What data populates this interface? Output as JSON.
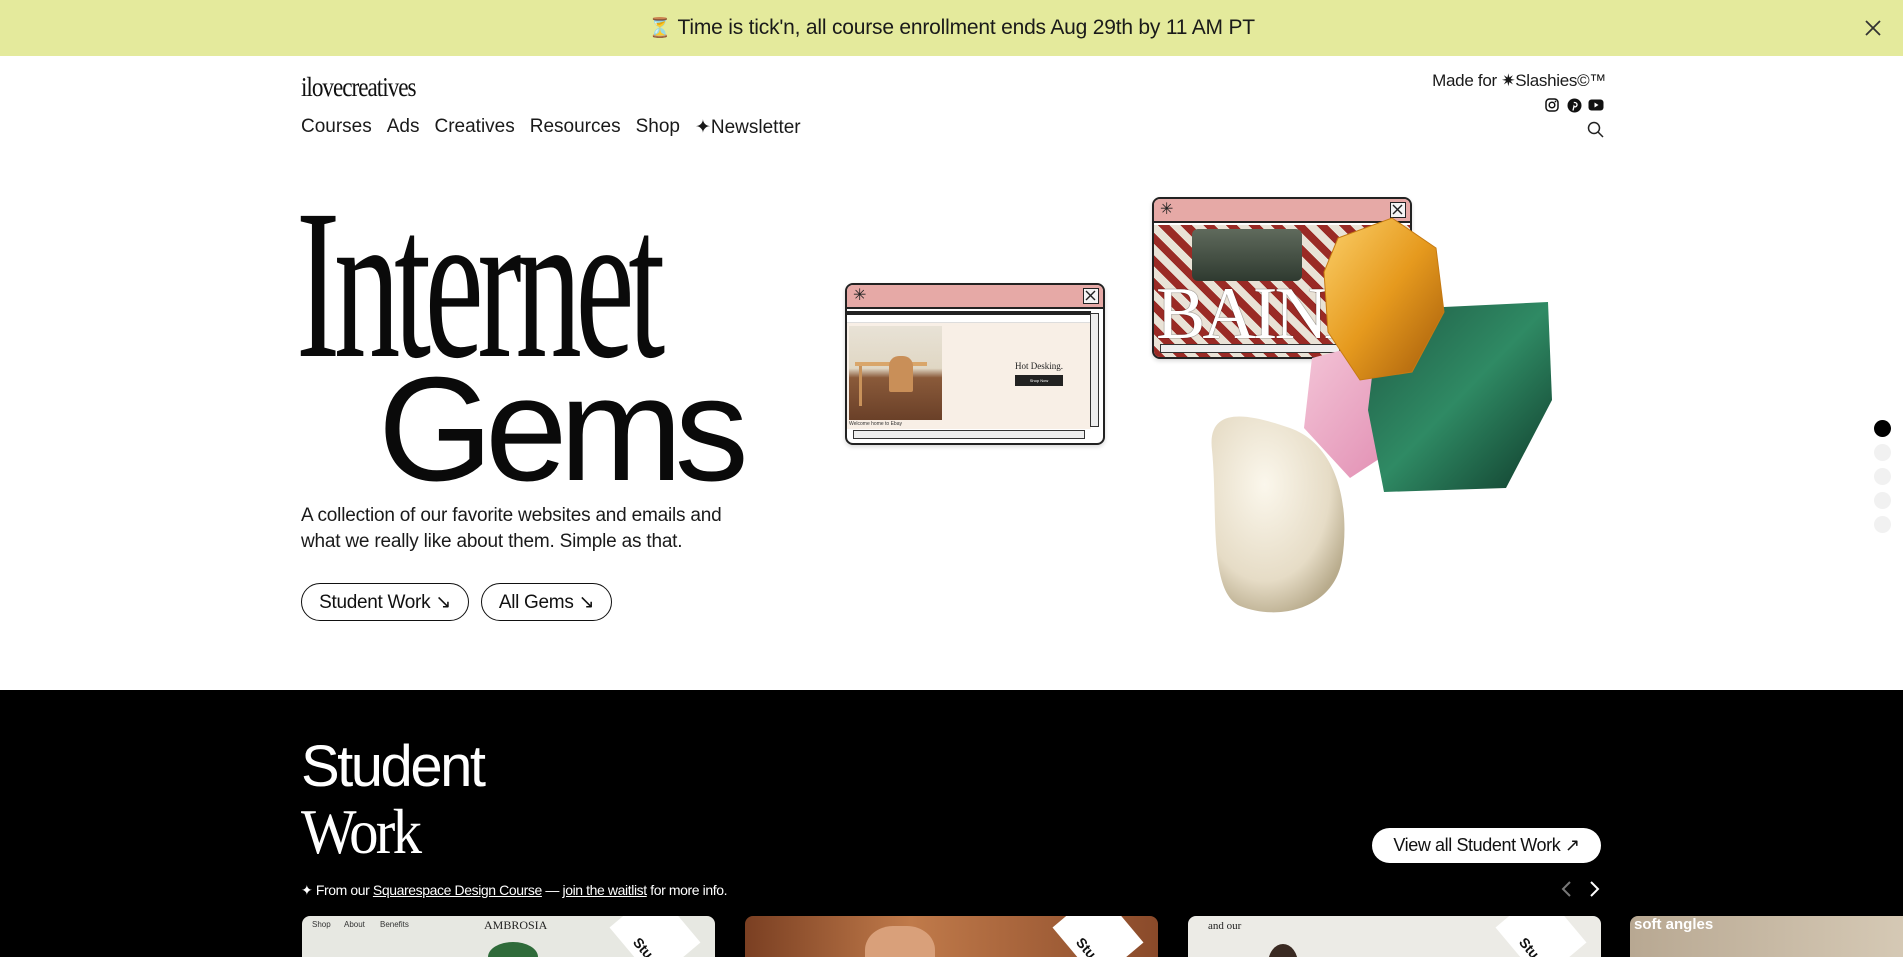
{
  "announcement": {
    "text": "Time is tick'n, all course enrollment ends Aug 29th by 11 AM PT",
    "close_icon": "close-icon"
  },
  "header": {
    "logo": "ilovecreatives",
    "nav": [
      "Courses",
      "Ads",
      "Creatives",
      "Resources",
      "Shop",
      "✦Newsletter"
    ],
    "made_for": "Made for ✷Slashies©™",
    "socials": [
      "instagram-icon",
      "pinterest-icon",
      "youtube-icon"
    ],
    "search_icon": "search-icon"
  },
  "hero": {
    "title_line1": "Internet",
    "title_line2": "Gems",
    "description": "A collection of our favorite websites and emails and what we really like about them. Simple as that.",
    "btn_student": "Student Work ↘",
    "btn_gems": "All Gems ↘",
    "window1": {
      "headline": "Hot Desking.",
      "button": "Shop Now",
      "caption": "Welcome home to Ebay"
    },
    "window2": {
      "wordmark": "BAINA"
    },
    "slide_count": 5,
    "active_slide": 1
  },
  "student_work": {
    "title_line1": "Student",
    "title_line2": "Work",
    "note_prefix": "✦ From our ",
    "note_link1": "Squarespace Design Course",
    "note_mid": " — ",
    "note_link2": "join the waitlist",
    "note_suffix": " for more info.",
    "view_all": "View all Student Work ↗",
    "cards": [
      {
        "label": "AMBROSIA",
        "nav": [
          "Shop",
          "About",
          "Benefits"
        ],
        "ribbon": "Stu"
      },
      {
        "label": "",
        "ribbon": "Stu"
      },
      {
        "label": "and our",
        "ribbon": "Stu"
      },
      {
        "label": "soft angles"
      }
    ]
  },
  "colors": {
    "announcement_bg": "#e4ea9c",
    "window_bar": "#e6a9a6",
    "section_bg": "#000000"
  }
}
